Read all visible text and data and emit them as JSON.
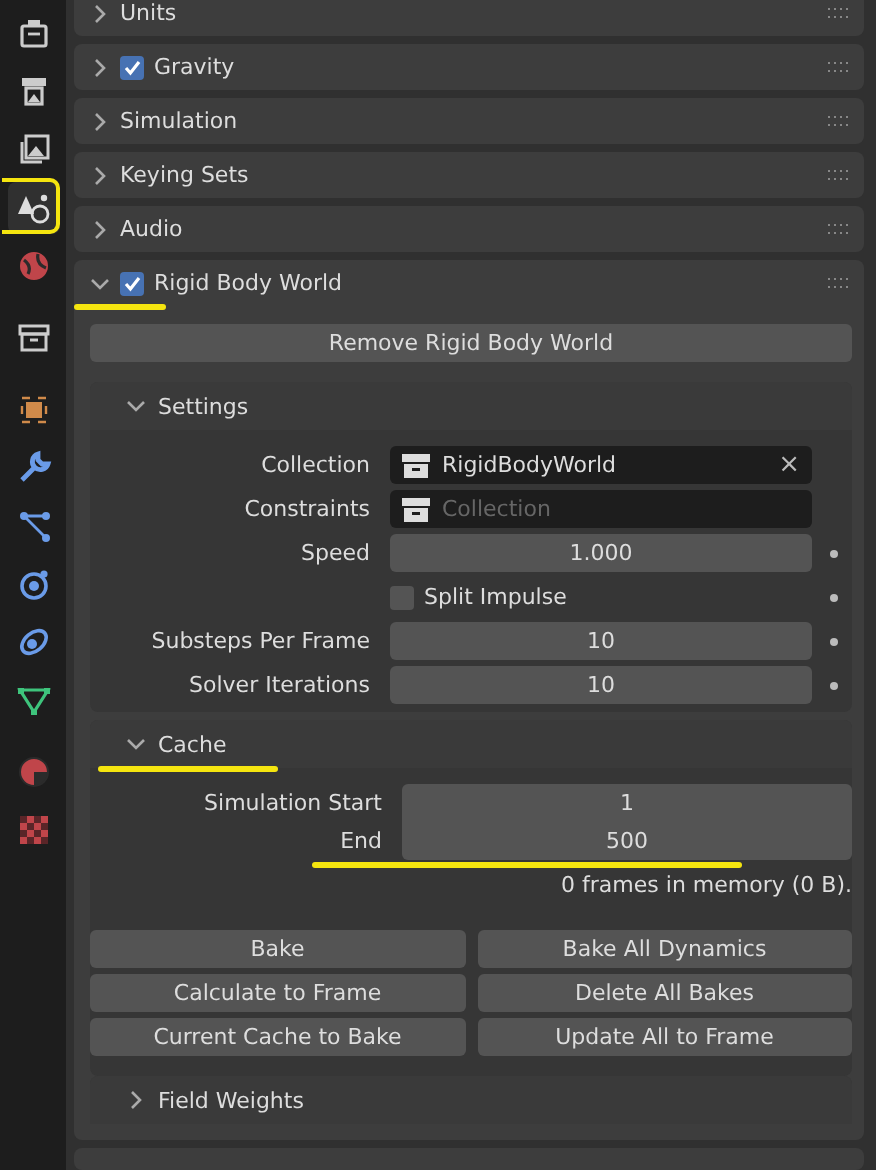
{
  "sidebar_tabs": [
    {
      "kind": "tool",
      "selected": false,
      "highlighted": false
    },
    {
      "kind": "render",
      "selected": false,
      "highlighted": false
    },
    {
      "kind": "output",
      "selected": false,
      "highlighted": false
    },
    {
      "kind": "scene",
      "selected": true,
      "highlighted": true
    },
    {
      "kind": "world",
      "selected": false,
      "highlighted": false
    },
    {
      "kind": "collection",
      "selected": false,
      "highlighted": false
    },
    {
      "kind": "object",
      "selected": false,
      "highlighted": false
    },
    {
      "kind": "modifier",
      "selected": false,
      "highlighted": false
    },
    {
      "kind": "particles",
      "selected": false,
      "highlighted": false
    },
    {
      "kind": "physics",
      "selected": false,
      "highlighted": false
    },
    {
      "kind": "constraints",
      "selected": false,
      "highlighted": false
    },
    {
      "kind": "data",
      "selected": false,
      "highlighted": false
    },
    {
      "kind": "material",
      "selected": false,
      "highlighted": false
    },
    {
      "kind": "texture",
      "selected": false,
      "highlighted": false
    }
  ],
  "panels": [
    {
      "label": "Units",
      "expanded": false,
      "highlighted": false
    },
    {
      "label": "Gravity",
      "expanded": false,
      "checked": true,
      "highlighted": false
    },
    {
      "label": "Simulation",
      "expanded": false,
      "highlighted": false
    },
    {
      "label": "Keying Sets",
      "expanded": false,
      "highlighted": false
    },
    {
      "label": "Audio",
      "expanded": false,
      "highlighted": false
    },
    {
      "label": "Rigid Body World",
      "expanded": true,
      "checked": true,
      "highlighted": true
    }
  ],
  "rigid_body_world": {
    "remove_button": "Remove Rigid Body World",
    "settings": {
      "label": "Settings",
      "expanded": true,
      "rows": [
        {
          "kind": "field",
          "label": "Collection",
          "value": "RigidBodyWorld",
          "clear": "×"
        },
        {
          "kind": "field",
          "label": "Constraints",
          "placeholder": "Collection"
        },
        {
          "kind": "number",
          "label": "Speed",
          "value": "1.000"
        },
        {
          "kind": "checkbox",
          "label": "Split Impulse",
          "checked": false
        },
        {
          "kind": "number",
          "label": "Substeps Per Frame",
          "value": "10"
        },
        {
          "kind": "number",
          "label": "Solver Iterations",
          "value": "10"
        }
      ]
    },
    "cache": {
      "label": "Cache",
      "expanded": true,
      "highlighted": true,
      "rows": [
        {
          "label": "Simulation Start",
          "value": "1",
          "highlighted": false
        },
        {
          "label": "End",
          "value": "500",
          "highlighted": true
        }
      ],
      "info": "0 frames in memory (0 B).",
      "buttons": [
        [
          "Bake",
          "Bake All Dynamics"
        ],
        [
          "Calculate to Frame",
          "Delete All Bakes"
        ],
        [
          "Current Cache to Bake",
          "Update All to Frame"
        ]
      ]
    },
    "field_weights": {
      "label": "Field Weights",
      "expanded": false
    }
  }
}
